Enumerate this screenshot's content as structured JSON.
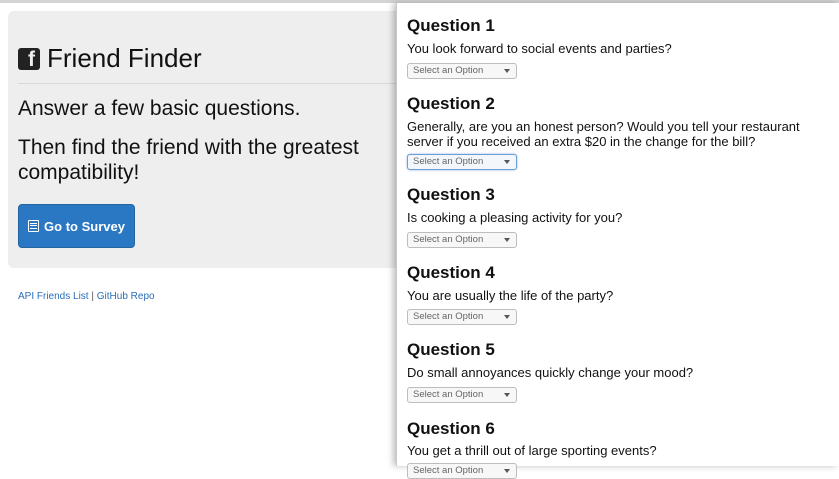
{
  "header": {
    "brand_icon": "facebook-square-icon",
    "title": "Friend Finder",
    "lead_line1": "Answer a few basic questions.",
    "lead_line2": "Then find the friend with the greatest compatibility!",
    "survey_button_label": "Go to Survey",
    "survey_button_icon": "list-alt-icon",
    "accent_color": "#2a77c4"
  },
  "footer": {
    "api_link": "API Friends List",
    "separator": "|",
    "github_link": "GitHub Repo"
  },
  "survey": {
    "select_placeholder": "Select an Option",
    "questions": [
      {
        "title": "Question 1",
        "text": "You look forward to social events and parties?",
        "value": "Select an Option"
      },
      {
        "title": "Question 2",
        "text": "Generally, are you an honest person? Would you tell your restaurant server if you received an extra $20 in the change for the bill?",
        "value": "Select an Option"
      },
      {
        "title": "Question 3",
        "text": "Is cooking a pleasing activity for you?",
        "value": "Select an Option"
      },
      {
        "title": "Question 4",
        "text": "You are usually the life of the party?",
        "value": "Select an Option"
      },
      {
        "title": "Question 5",
        "text": "Do small annoyances quickly change your mood?",
        "value": "Select an Option"
      },
      {
        "title": "Question 6",
        "text": "You get a thrill out of large sporting events?",
        "value": "Select an Option"
      }
    ]
  }
}
